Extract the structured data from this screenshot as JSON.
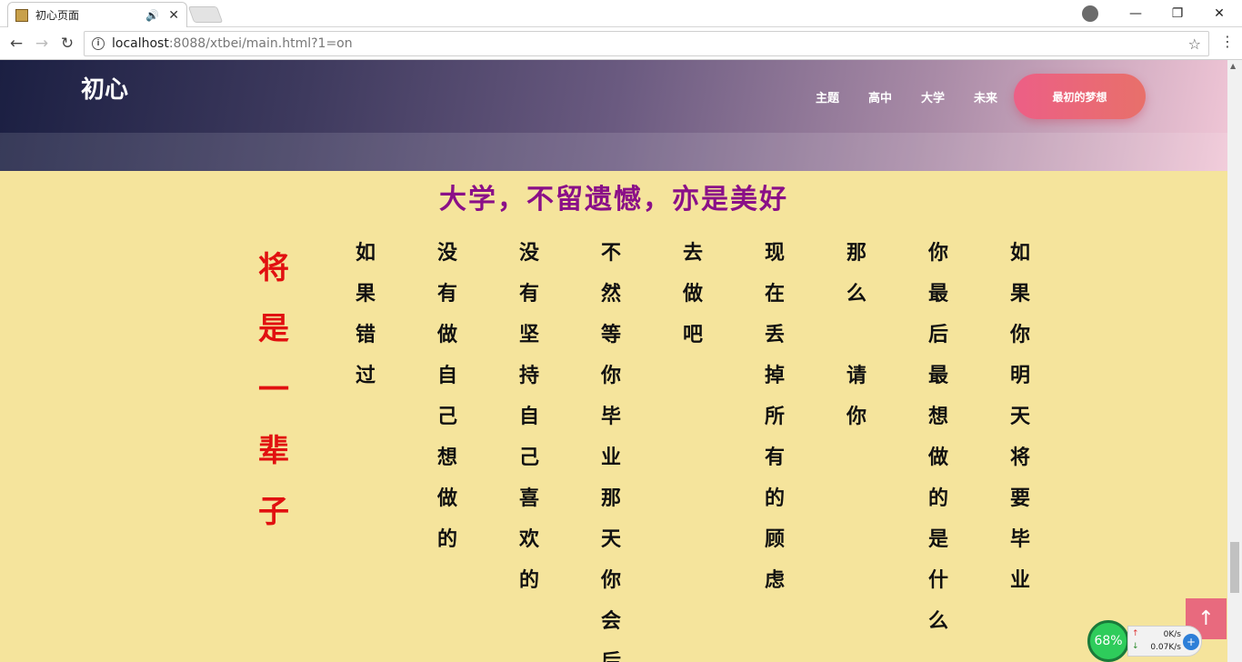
{
  "browser": {
    "tab_title": "初心页面",
    "tab_audio_icon": "speaker-icon",
    "tab_close_icon": "close-icon",
    "url_host": "localhost",
    "url_rest": ":8088/xtbei/main.html?1=on",
    "window_controls": [
      "minimize-icon",
      "maximize-icon",
      "close-icon"
    ]
  },
  "header": {
    "brand": "初心",
    "nav": [
      "主题",
      "高中",
      "大学",
      "未来"
    ],
    "cta_label": "最初的梦想"
  },
  "content": {
    "headline": "大学，不留遗憾，亦是美好",
    "side_text": [
      "将",
      "是",
      "一",
      "辈",
      "子"
    ],
    "columns": [
      [
        "如",
        "果",
        "错",
        "过"
      ],
      [
        "没",
        "有",
        "做",
        "自",
        "己",
        "想",
        "做",
        "的"
      ],
      [
        "没",
        "有",
        "坚",
        "持",
        "自",
        "己",
        "喜",
        "欢",
        "的"
      ],
      [
        "不",
        "然",
        "等",
        "你",
        "毕",
        "业",
        "那",
        "天",
        "你",
        "会",
        "后"
      ],
      [
        "去",
        "做",
        "吧"
      ],
      [
        "现",
        "在",
        "丢",
        "掉",
        "所",
        "有",
        "的",
        "顾",
        "虑"
      ],
      [
        "那",
        "么",
        "",
        "请",
        "你"
      ],
      [
        "你",
        "最",
        "后",
        "最",
        "想",
        "做",
        "的",
        "是",
        "什",
        "么"
      ],
      [
        "如",
        "果",
        "你",
        "明",
        "天",
        "将",
        "要",
        "毕",
        "业"
      ]
    ]
  },
  "scroll_top_icon": "arrow-up-icon",
  "net_widget": {
    "percent": "68%",
    "upload": "0K/s",
    "download": "0.07K/s"
  }
}
